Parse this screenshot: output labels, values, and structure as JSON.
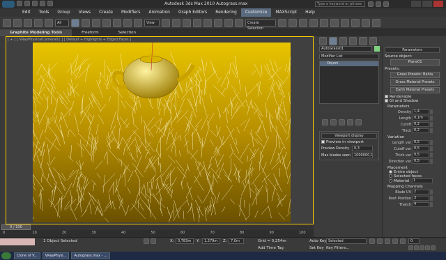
{
  "window": {
    "title": "Autodesk 3ds Max  2010       Autograss.max",
    "search_placeholder": "Type a keyword or phrase"
  },
  "menu": [
    "Edit",
    "Tools",
    "Group",
    "Views",
    "Create",
    "Modifiers",
    "Animation",
    "Graph Editors",
    "Rendering",
    "Customize",
    "MAXScript",
    "Help"
  ],
  "menu_active": "Customize",
  "toolbar": {
    "filter": "All",
    "view": "View",
    "selection_set": "Create Selection"
  },
  "ribbon": {
    "tabs": [
      "Graphite Modeling Tools",
      "Freeform",
      "Selection"
    ]
  },
  "viewport": {
    "label": "[ + ] [ VRayPhysicalCamera01 ] [ Default + Highlights + Edged Faces ]"
  },
  "modifier": {
    "object_name": "AutoGrass01",
    "list_label": "Modifier List",
    "stack_item": "Object"
  },
  "viewport_display": {
    "title": "Viewport display",
    "preview": "Preview in viewport",
    "density_label": "Preview Density",
    "density_value": "0,3",
    "max_blades_label": "Max blades seen",
    "max_blades_value": "1000000,0"
  },
  "params": {
    "title": "Parameters",
    "source_label": "Source object:",
    "source_value": "Plane01",
    "presets_label": "Presets:",
    "preset_buttons": [
      "Grass Presets: Bahia",
      "Grass Material Presets",
      "Earth Material Presets"
    ],
    "renderable": "Renderable",
    "gi": "GI and Shadow",
    "parameters_label": "Parameters",
    "rows": [
      {
        "l": "Density",
        "v": "1,4"
      },
      {
        "l": "Length",
        "v": "0,1m"
      },
      {
        "l": "Cutoff",
        "v": "0,2"
      },
      {
        "l": "Thick",
        "v": "0,2"
      }
    ],
    "variation_label": "Variation",
    "variation": [
      {
        "l": "Length var",
        "v": "0,5"
      },
      {
        "l": "Cutoff var",
        "v": "0,5"
      },
      {
        "l": "Thick var",
        "v": "0,5"
      },
      {
        "l": "Direction var",
        "v": "0,5"
      }
    ],
    "placement_label": "Placement",
    "placement": [
      "Entire object",
      "Selected faces",
      "Material"
    ],
    "material_value": "1",
    "mapping_label": "Mapping Channels",
    "mapping": [
      {
        "l": "Blade UV",
        "v": "2"
      },
      {
        "l": "Root Position",
        "v": "3"
      },
      {
        "l": "Thatch",
        "v": "4"
      }
    ]
  },
  "timeline": {
    "frame": "0 / 100",
    "ticks": [
      "0",
      "10",
      "20",
      "30",
      "40",
      "50",
      "60",
      "70",
      "80",
      "90",
      "100"
    ]
  },
  "status": {
    "selected": "1 Object Selected",
    "x_label": "X:",
    "x": "0,783m",
    "y_label": "Y:",
    "y": "1,279m",
    "z_label": "Z:",
    "z": "7,0m",
    "grid": "Grid = 0,254m",
    "add_time_tag": "Add Time Tag",
    "auto_key": "Auto Key",
    "selected_dd": "Selected",
    "set_key": "Set Key",
    "key_filters": "Key Filters...",
    "frame_field": "0"
  },
  "taskbar": {
    "items": [
      "Clone of V...",
      "VRayPhysi...",
      "Autograss.max - ..."
    ]
  },
  "colors": {
    "grass_gold": "#d8b000",
    "viewport_border": "#ffd000",
    "taskbar": "#1e2a44"
  }
}
